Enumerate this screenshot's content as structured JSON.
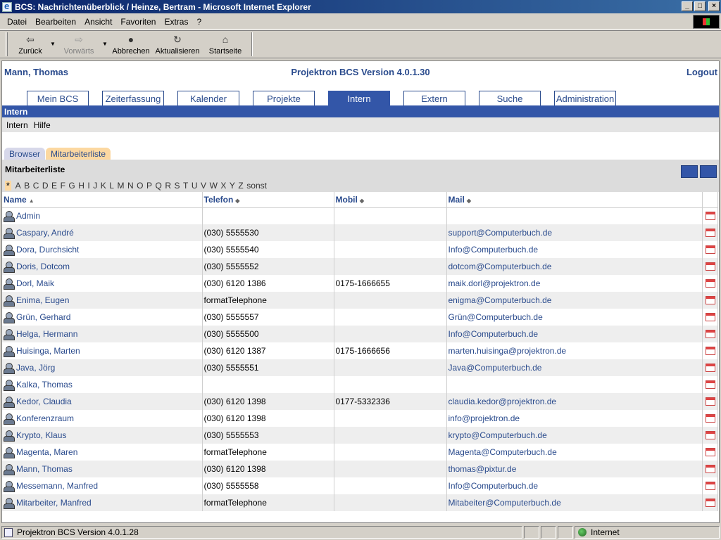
{
  "window": {
    "title": "BCS: Nachrichtenüberblick / Heinze, Bertram - Microsoft Internet Explorer",
    "min": "_",
    "max": "□",
    "close": "×"
  },
  "menu": [
    "Datei",
    "Bearbeiten",
    "Ansicht",
    "Favoriten",
    "Extras",
    "?"
  ],
  "toolbar": {
    "back": "Zurück",
    "forward": "Vorwärts",
    "stop": "Abbrechen",
    "refresh": "Aktualisieren",
    "home": "Startseite"
  },
  "header": {
    "user": "Mann, Thomas",
    "product": "Projektron BCS Version 4.0.1.30",
    "logout": "Logout"
  },
  "tabs": [
    "Mein BCS",
    "Zeiterfassung",
    "Kalender",
    "Projekte",
    "Intern",
    "Extern",
    "Suche",
    "Administration"
  ],
  "active_tab": "Intern",
  "section_title": "Intern",
  "subnav": [
    "Intern",
    "Hilfe"
  ],
  "subtabs": {
    "browser": "Browser",
    "list": "Mitarbeiterliste"
  },
  "list_title": "Mitarbeiterliste",
  "alphabet": [
    "*",
    "A",
    "B",
    "C",
    "D",
    "E",
    "F",
    "G",
    "H",
    "I",
    "J",
    "K",
    "L",
    "M",
    "N",
    "O",
    "P",
    "Q",
    "R",
    "S",
    "T",
    "U",
    "V",
    "W",
    "X",
    "Y",
    "Z",
    "sonst"
  ],
  "columns": {
    "name": "Name",
    "phone": "Telefon",
    "mobile": "Mobil",
    "mail": "Mail"
  },
  "rows": [
    {
      "name": "Admin",
      "phone": "",
      "mobile": "",
      "mail": ""
    },
    {
      "name": "Caspary, André",
      "phone": "(030) 5555530",
      "mobile": "",
      "mail": "support@Computerbuch.de"
    },
    {
      "name": "Dora, Durchsicht",
      "phone": "(030) 5555540",
      "mobile": "",
      "mail": "Info@Computerbuch.de"
    },
    {
      "name": "Doris, Dotcom",
      "phone": "(030) 5555552",
      "mobile": "",
      "mail": "dotcom@Computerbuch.de"
    },
    {
      "name": "Dorl, Maik",
      "phone": "(030) 6120 1386",
      "mobile": "0175-1666655",
      "mail": "maik.dorl@projektron.de"
    },
    {
      "name": "Enima, Eugen",
      "phone": "formatTelephone",
      "mobile": "",
      "mail": "enigma@Computerbuch.de"
    },
    {
      "name": "Grün, Gerhard",
      "phone": "(030) 5555557",
      "mobile": "",
      "mail": "Grün@Computerbuch.de"
    },
    {
      "name": "Helga, Hermann",
      "phone": "(030) 5555500",
      "mobile": "",
      "mail": "Info@Computerbuch.de"
    },
    {
      "name": "Huisinga, Marten",
      "phone": "(030) 6120 1387",
      "mobile": "0175-1666656",
      "mail": "marten.huisinga@projektron.de"
    },
    {
      "name": "Java, Jörg",
      "phone": "(030) 5555551",
      "mobile": "",
      "mail": "Java@Computerbuch.de"
    },
    {
      "name": "Kalka, Thomas",
      "phone": "",
      "mobile": "",
      "mail": ""
    },
    {
      "name": "Kedor, Claudia",
      "phone": "(030) 6120 1398",
      "mobile": "0177-5332336",
      "mail": "claudia.kedor@projektron.de"
    },
    {
      "name": "Konferenzraum",
      "phone": "(030) 6120 1398",
      "mobile": "",
      "mail": "info@projektron.de"
    },
    {
      "name": "Krypto, Klaus",
      "phone": "(030) 5555553",
      "mobile": "",
      "mail": "krypto@Computerbuch.de"
    },
    {
      "name": "Magenta, Maren",
      "phone": "formatTelephone",
      "mobile": "",
      "mail": "Magenta@Computerbuch.de"
    },
    {
      "name": "Mann, Thomas",
      "phone": "(030) 6120 1398",
      "mobile": "",
      "mail": "thomas@pixtur.de"
    },
    {
      "name": "Messemann, Manfred",
      "phone": "(030) 5555558",
      "mobile": "",
      "mail": "Info@Computerbuch.de"
    },
    {
      "name": "Mitarbeiter, Manfred",
      "phone": "formatTelephone",
      "mobile": "",
      "mail": "Mitabeiter@Computerbuch.de"
    }
  ],
  "status": {
    "text": "Projektron BCS Version 4.0.1.28",
    "zone": "Internet"
  }
}
